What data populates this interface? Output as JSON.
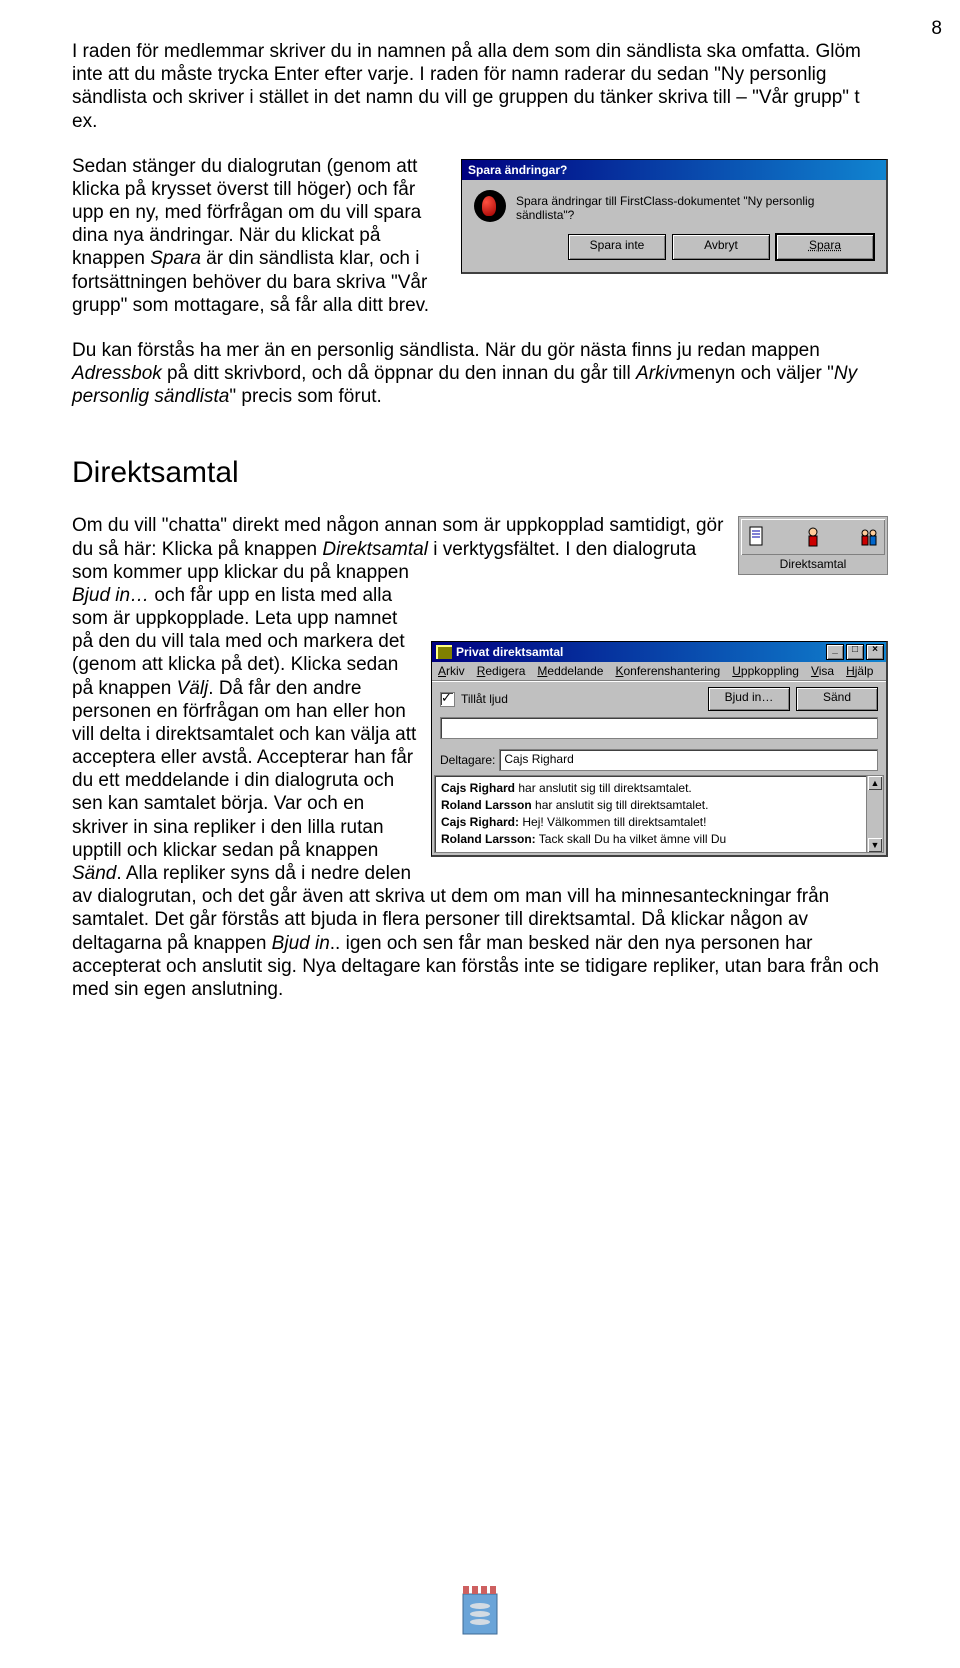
{
  "page_number": "8",
  "para1": "I raden för medlemmar skriver du in namnen på alla dem som din sändlista ska omfatta. Glöm inte att du måste trycka Enter efter varje. I raden för namn raderar du sedan \"Ny personlig sändlista och skriver i stället in det namn du vill ge gruppen du tänker skriva till – \"Vår grupp\" t ex.",
  "para2_a": "Sedan stänger du dialogrutan (genom att klicka på krysset överst till höger) och får upp en ny, med förfrågan om du vill spara dina nya ändringar. När du klickat på knappen ",
  "para2_b": "Spara",
  "para2_c": " är din sändlista klar, och i fortsättningen behöver du bara skriva \"Vår grupp\" som mottagare, så får alla ditt brev.",
  "para3_a": "Du kan förstås ha mer än en personlig sändlista. När du gör nästa finns ju redan mappen ",
  "para3_b": "Adressbok",
  "para3_c": " på ditt skrivbord, och då öppnar du den innan du går till ",
  "para3_d": "Arkiv",
  "para3_e": "menyn och väljer \"",
  "para3_f": "Ny personlig sändlista",
  "para3_g": "\" precis som förut.",
  "heading2": "Direktsamtal",
  "para4_a": "Om du vill \"chatta\" direkt med någon annan som är uppkopplad samtidigt, gör du så här: Klicka på knappen ",
  "para4_b": "Direktsamtal",
  "para4_c": " i verktygsfältet. I den dialogruta som kommer upp klickar du på knappen ",
  "para4_d": "Bjud in…",
  "para4_e": " och får upp en lista med alla som är uppkopplade. Leta upp namnet på den du vill tala med och markera det (genom att klicka på det). Klicka sedan på knappen ",
  "para4_f": "Välj",
  "para4_g": ". Då får den andre personen en förfrågan om han eller hon vill delta i direktsamtalet och kan välja att acceptera eller avstå. Accepterar han får du ett meddelande i din dialogruta och sen kan samtalet börja. Var och en skriver in sina repliker i den lilla rutan upptill och klickar sedan på knappen ",
  "para4_h": "Sänd",
  "para4_i": ". Alla repliker syns då i nedre delen av dialogrutan, och det går även att skriva ut dem om man vill ha minnesanteckningar från samtalet. Det går förstås att bjuda in flera personer till direktsamtal. Då klickar någon av deltagarna på knappen ",
  "para4_j": "Bjud in",
  "para4_k": ".. igen och sen får man besked när den nya personen har accepterat och anslutit sig. Nya deltagare kan förstås inte se tidigare repliker, utan bara från och med sin egen anslutning.",
  "dialog1": {
    "title": "Spara ändringar?",
    "message": "Spara ändringar till FirstClass-dokumentet \"Ny personlig sändlista\"?",
    "btn_no": "Spara inte",
    "btn_cancel": "Avbryt",
    "btn_save": "Spara"
  },
  "snippet": {
    "label": "Direktsamtal"
  },
  "dialog2": {
    "title": "Privat direktsamtal",
    "menu": {
      "arkiv": "Arkiv",
      "redigera": "Redigera",
      "meddelande": "Meddelande",
      "konferens": "Konferenshantering",
      "uppkoppling": "Uppkoppling",
      "visa": "Visa",
      "hjalp": "Hjälp"
    },
    "tillat": "Tillåt ljud",
    "btn_invite": "Bjud in…",
    "btn_send": "Sänd",
    "deltagare_label": "Deltagare:",
    "deltagare_value": "Cajs Righard",
    "log": [
      {
        "who": "Cajs Righard",
        "text": " har anslutit sig till direktsamtalet."
      },
      {
        "who": "Roland Larsson",
        "text": " har anslutit sig till direktsamtalet."
      },
      {
        "who": "Cajs Righard:",
        "text": " Hej! Välkommen till direktsamtalet!"
      },
      {
        "who": "Roland Larsson:",
        "text": " Tack skall Du ha vilket ämne vill Du"
      }
    ]
  }
}
